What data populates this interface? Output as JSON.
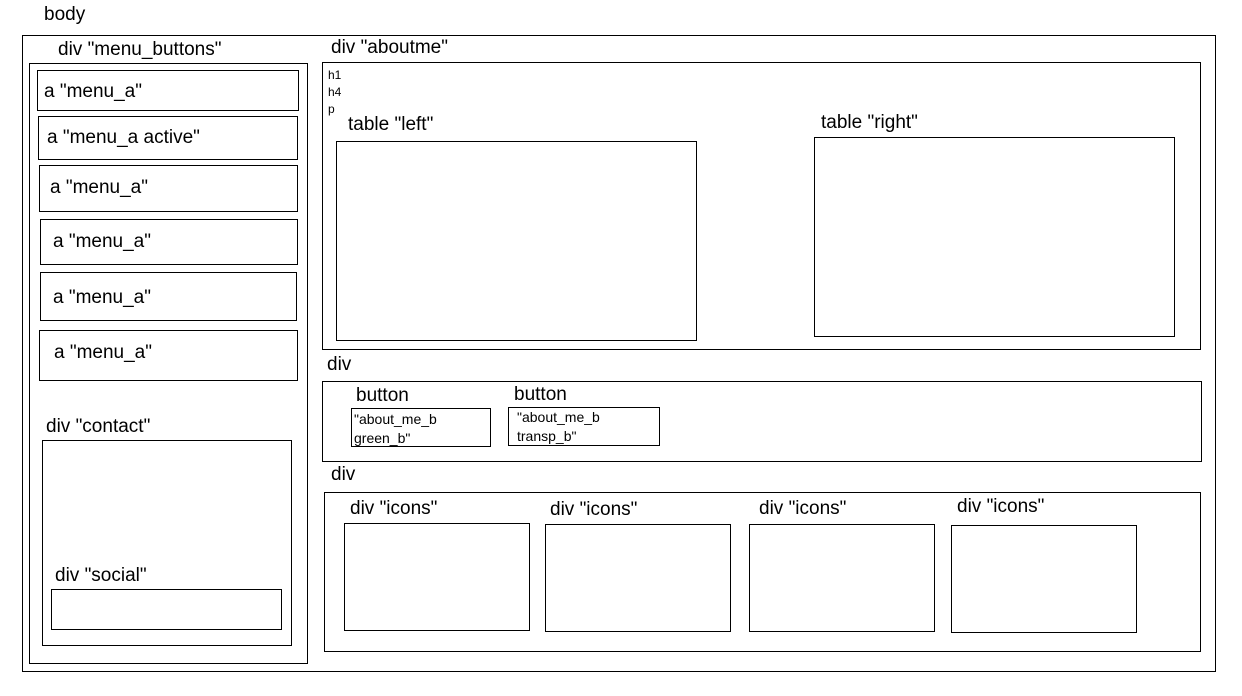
{
  "labels": {
    "body": "body",
    "menu_buttons": "div \"menu_buttons\"",
    "aboutme": "div \"aboutme\"",
    "h1": "h1",
    "h4": "h4",
    "p": "p",
    "table_left": "table \"left\"",
    "table_right": "table \"right\"",
    "div_buttons": "div",
    "button": "button",
    "div_icons_section": "div",
    "icons": "div \"icons\"",
    "contact": "div \"contact\"",
    "social": "div \"social\""
  },
  "menu_items": [
    "a \"menu_a\"",
    "a  \"menu_a   active\"",
    "a  \"menu_a\"",
    "a  \"menu_a\"",
    "a   \"menu_a\"",
    "a   \"menu_a\""
  ],
  "buttons": [
    {
      "line1": "\"about_me_b",
      "line2": "green_b\""
    },
    {
      "line1": " \"about_me_b",
      "line2": " transp_b\""
    }
  ]
}
